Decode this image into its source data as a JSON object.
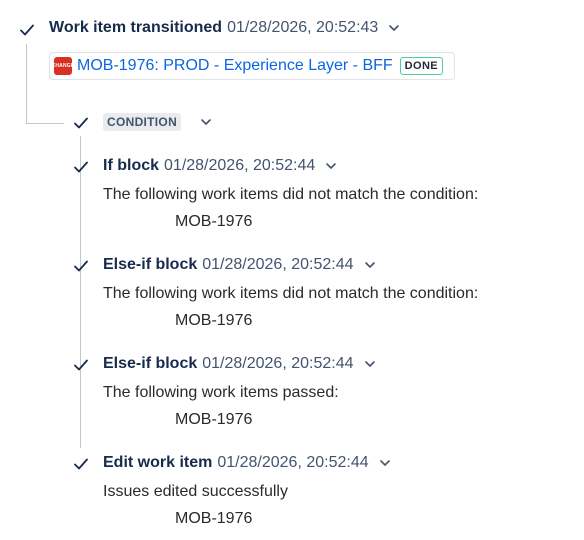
{
  "trigger": {
    "title": "Work item transitioned",
    "timestamp": "01/28/2026, 20:52:43",
    "issue": {
      "icon_text": "CHANGE",
      "link_text": "MOB-1976: PROD - Experience Layer - BFF",
      "status": "DONE"
    }
  },
  "condition": {
    "label": "CONDITION"
  },
  "blocks": [
    {
      "title": "If block",
      "timestamp": "01/28/2026, 20:52:44",
      "message": "The following work items did not match the condition:",
      "key": "MOB-1976"
    },
    {
      "title": "Else-if block",
      "timestamp": "01/28/2026, 20:52:44",
      "message": "The following work items did not match the condition:",
      "key": "MOB-1976"
    },
    {
      "title": "Else-if block",
      "timestamp": "01/28/2026, 20:52:44",
      "message": "The following work items passed:",
      "key": "MOB-1976"
    },
    {
      "title": "Edit work item",
      "timestamp": "01/28/2026, 20:52:44",
      "message": "Issues edited successfully",
      "key": "MOB-1976"
    }
  ],
  "colors": {
    "link": "#0c66e4",
    "done_border": "#4bce97",
    "issue_icon": "#d93025",
    "connector": "#c1c7d0"
  }
}
